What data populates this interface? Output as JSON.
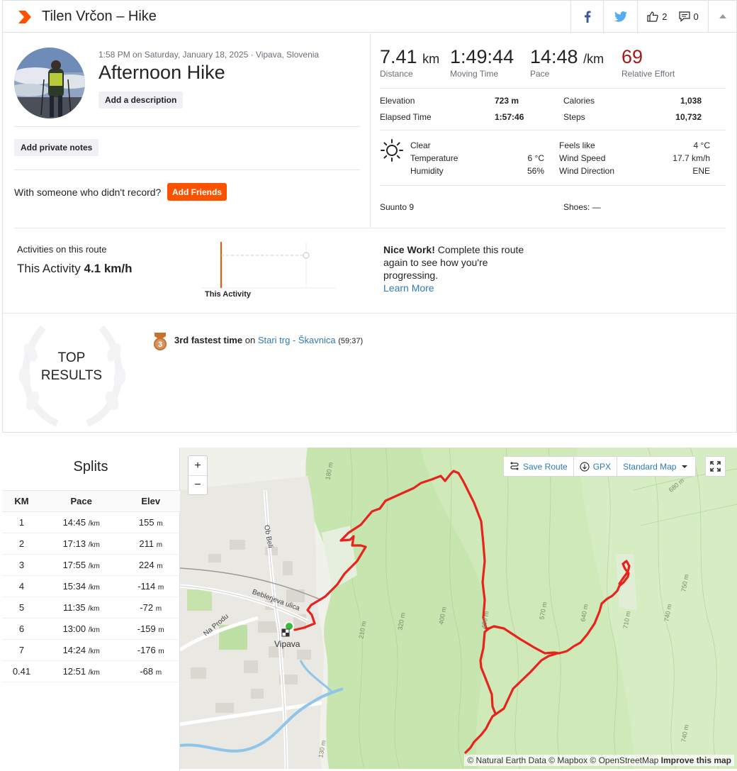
{
  "header": {
    "title": "Tilen Vrčon – Hike",
    "kudos_count": "2",
    "comments_count": "0",
    "brand_color": "#fc5200"
  },
  "activity": {
    "datetime": "1:58 PM on Saturday, January 18, 2025 · Vipava, Slovenia",
    "name": "Afternoon Hike",
    "add_description": "Add a description",
    "add_private_notes": "Add private notes",
    "with_someone": "With someone who didn't record?",
    "add_friends": "Add Friends"
  },
  "stats": {
    "distance": {
      "value": "7.41",
      "unit": "km",
      "label": "Distance"
    },
    "moving_time": {
      "value": "1:49:44",
      "label": "Moving Time"
    },
    "pace": {
      "value": "14:48",
      "unit": "/km",
      "label": "Pace"
    },
    "relative_effort": {
      "value": "69",
      "label": "Relative Effort",
      "color": "#a31a1a"
    }
  },
  "details": {
    "elevation_label": "Elevation",
    "elevation_value": "723 m",
    "elapsed_label": "Elapsed Time",
    "elapsed_value": "1:57:46",
    "calories_label": "Calories",
    "calories_value": "1,038",
    "steps_label": "Steps",
    "steps_value": "10,732"
  },
  "weather": {
    "condition": "Clear",
    "temperature_label": "Temperature",
    "temperature_value": "6 °C",
    "humidity_label": "Humidity",
    "humidity_value": "56%",
    "feels_like_label": "Feels like",
    "feels_like_value": "4 °C",
    "wind_speed_label": "Wind Speed",
    "wind_speed_value": "17.7 km/h",
    "wind_dir_label": "Wind Direction",
    "wind_dir_value": "ENE"
  },
  "gear": {
    "device": "Suunto 9",
    "shoes": "Shoes: —"
  },
  "route": {
    "label": "Activities on this route",
    "this_activity_prefix": "This Activity",
    "this_activity_speed": "4.1 km/h",
    "chart_label": "This Activity",
    "nice_work": "Nice Work!",
    "nice_text": "Complete this route again to see how you're progressing.",
    "learn_more": "Learn More"
  },
  "top_results": {
    "title_line1": "TOP",
    "title_line2": "RESULTS",
    "medal_rank": "3",
    "achievement": "3rd fastest time",
    "on": "on",
    "segment": "Stari trg - Škavnica",
    "segment_time": "(59:37)"
  },
  "splits": {
    "title": "Splits",
    "headers": [
      "KM",
      "Pace",
      "Elev"
    ],
    "pace_unit": "/km",
    "elev_unit": "m",
    "rows": [
      {
        "km": "1",
        "pace": "14:45",
        "elev": "155"
      },
      {
        "km": "2",
        "pace": "17:13",
        "elev": "211"
      },
      {
        "km": "3",
        "pace": "17:55",
        "elev": "224"
      },
      {
        "km": "4",
        "pace": "15:34",
        "elev": "-114"
      },
      {
        "km": "5",
        "pace": "11:35",
        "elev": "-72"
      },
      {
        "km": "6",
        "pace": "13:00",
        "elev": "-159"
      },
      {
        "km": "7",
        "pace": "14:24",
        "elev": "-176"
      },
      {
        "km": "0.41",
        "pace": "12:51",
        "elev": "-68"
      }
    ]
  },
  "map": {
    "zoom_in": "+",
    "zoom_out": "−",
    "save_route": "Save Route",
    "gpx": "GPX",
    "map_type": "Standard Map",
    "town": "Vipava",
    "street1": "Bebler­jeva ulica",
    "street2": "Na Produ",
    "street3": "Ob Beli",
    "attribution_prefix": "© Natural Earth Data © Mapbox © OpenStreetMap",
    "improve": "Improve this map",
    "route_color": "#e8221c",
    "contours": [
      "180 m",
      "210 m",
      "320 m",
      "400 m",
      "490 m",
      "570 m",
      "640 m",
      "710 m",
      "740 m",
      "750 m",
      "680 m",
      "740 m",
      "130 m"
    ]
  }
}
